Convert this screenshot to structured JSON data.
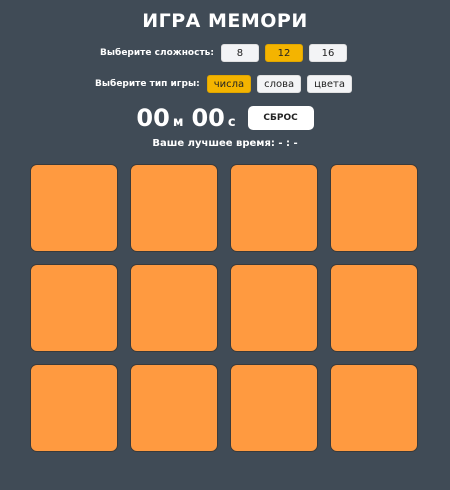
{
  "title": "ИГРА МЕМОРИ",
  "difficulty": {
    "label": "Выберите сложность:",
    "options": [
      "8",
      "12",
      "16"
    ],
    "selected": "12"
  },
  "game_type": {
    "label": "Выберите тип игры:",
    "options": [
      "числа",
      "слова",
      "цвета"
    ],
    "selected": "числа"
  },
  "timer": {
    "minutes": "00",
    "minutes_unit": "м",
    "seconds": "00",
    "seconds_unit": "с"
  },
  "reset_label": "СБРОС",
  "best_time": "Ваше лучшее время: - : -",
  "board": {
    "cards_count": 12,
    "card_color": "#ff9a40"
  },
  "colors": {
    "background": "#404b56",
    "accent": "#f4b400",
    "card": "#ff9a40"
  }
}
